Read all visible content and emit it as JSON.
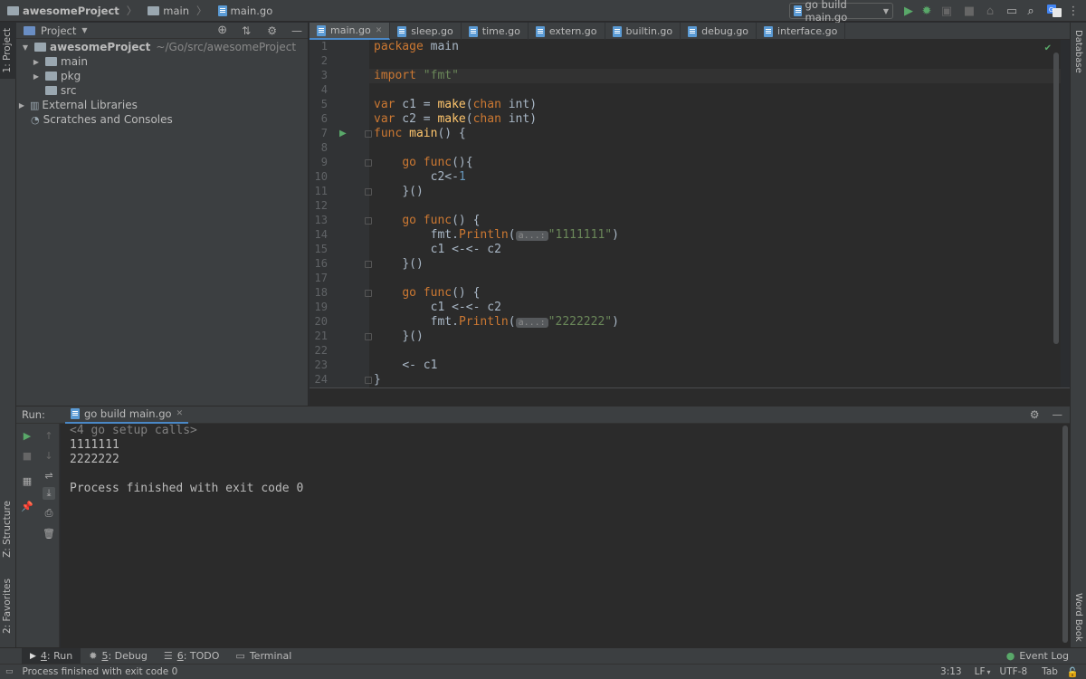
{
  "navbar": {
    "project": "awesomeProject",
    "folder": "main",
    "file": "main.go",
    "run_config": "go build main.go",
    "icons": [
      "run-icon",
      "debug-icon",
      "coverage-icon",
      "stop-icon",
      "build-icon",
      "project-structure-icon",
      "search-icon",
      "translate-icon"
    ]
  },
  "left_stripe": {
    "project_tab": "1: Project",
    "structure_tab": "Z: Structure",
    "favorites_tab": "2: Favorites"
  },
  "right_stripe": {
    "database_tab": "Database",
    "wordbook_tab": "Word Book"
  },
  "project_panel": {
    "view": "Project",
    "tree": [
      {
        "label": "awesomeProject",
        "path": "~/Go/src/awesomeProject",
        "level": 0,
        "expanded": true,
        "type": "project"
      },
      {
        "label": "main",
        "level": 1,
        "expanded": false,
        "type": "folder"
      },
      {
        "label": "pkg",
        "level": 1,
        "expanded": false,
        "type": "folder"
      },
      {
        "label": "src",
        "level": 1,
        "type": "folder"
      },
      {
        "label": "External Libraries",
        "level": 0,
        "expanded": false,
        "type": "library"
      },
      {
        "label": "Scratches and Consoles",
        "level": 0,
        "type": "scratch"
      }
    ]
  },
  "editor": {
    "tabs": [
      {
        "label": "main.go",
        "active": true
      },
      {
        "label": "sleep.go"
      },
      {
        "label": "time.go"
      },
      {
        "label": "extern.go"
      },
      {
        "label": "builtin.go"
      },
      {
        "label": "debug.go"
      },
      {
        "label": "interface.go"
      }
    ],
    "line_numbers": [
      "1",
      "2",
      "3",
      "4",
      "5",
      "6",
      "7",
      "8",
      "9",
      "10",
      "11",
      "12",
      "13",
      "14",
      "15",
      "16",
      "17",
      "18",
      "19",
      "20",
      "21",
      "22",
      "23",
      "24"
    ],
    "code": {
      "l1": {
        "kw": "package",
        "rest": " main"
      },
      "l3": {
        "kw": "import",
        "str": "\"fmt\""
      },
      "l5": {
        "kw": "var",
        "name": " c1 = ",
        "fn": "make",
        "open": "(",
        "kw2": "chan",
        "type": " int",
        "close": ")"
      },
      "l6": {
        "kw": "var",
        "name": " c2 = ",
        "fn": "make",
        "open": "(",
        "kw2": "chan",
        "type": " int",
        "close": ")"
      },
      "l7": {
        "kw": "func",
        "fn": " main",
        "rest": "() {"
      },
      "l9": {
        "indent": "    ",
        "kw": "go",
        "kw2": " func",
        "rest": "(){"
      },
      "l10": {
        "indent": "        ",
        "rest": "c2<-",
        "num": "1"
      },
      "l11": {
        "indent": "    ",
        "rest": "}()"
      },
      "l13": {
        "indent": "    ",
        "kw": "go",
        "kw2": " func",
        "rest": "() {"
      },
      "l14": {
        "indent": "        ",
        "pkg": "fmt.",
        "call": "Println",
        "open": "(",
        "hint": "a...:",
        "str": "\"1111111\"",
        "close": ")"
      },
      "l15": {
        "indent": "        ",
        "rest": "c1 <-<- c2"
      },
      "l16": {
        "indent": "    ",
        "rest": "}()"
      },
      "l18": {
        "indent": "    ",
        "kw": "go",
        "kw2": " func",
        "rest": "() {"
      },
      "l19": {
        "indent": "        ",
        "rest": "c1 <-<- c2"
      },
      "l20": {
        "indent": "        ",
        "pkg": "fmt.",
        "call": "Println",
        "open": "(",
        "hint": "a...:",
        "str": "\"2222222\"",
        "close": ")"
      },
      "l21": {
        "indent": "    ",
        "rest": "}()"
      },
      "l23": {
        "indent": "    ",
        "rest": "<- c1"
      },
      "l24": {
        "rest": "}"
      }
    }
  },
  "run_panel": {
    "label": "Run:",
    "tab": "go build main.go",
    "output": [
      "<4 go setup calls>",
      "1111111",
      "2222222",
      "",
      "Process finished with exit code 0"
    ]
  },
  "bottom_tabs": [
    {
      "num": "4",
      "label": ": Run",
      "active": true
    },
    {
      "num": "5",
      "label": ": Debug"
    },
    {
      "num": "6",
      "label": ": TODO"
    },
    {
      "num": "",
      "label": "Terminal"
    }
  ],
  "event_log": "Event Log",
  "status_bar": {
    "message": "Process finished with exit code 0",
    "position": "3:13",
    "line_sep": "LF",
    "encoding": "UTF-8",
    "indent": "Tab"
  },
  "colors": {
    "keyword": "#cc7832",
    "function": "#ffc66d",
    "string": "#6a8759",
    "number": "#6897bb",
    "run_green": "#59a869",
    "active_tab_underline": "#4a88c7"
  }
}
